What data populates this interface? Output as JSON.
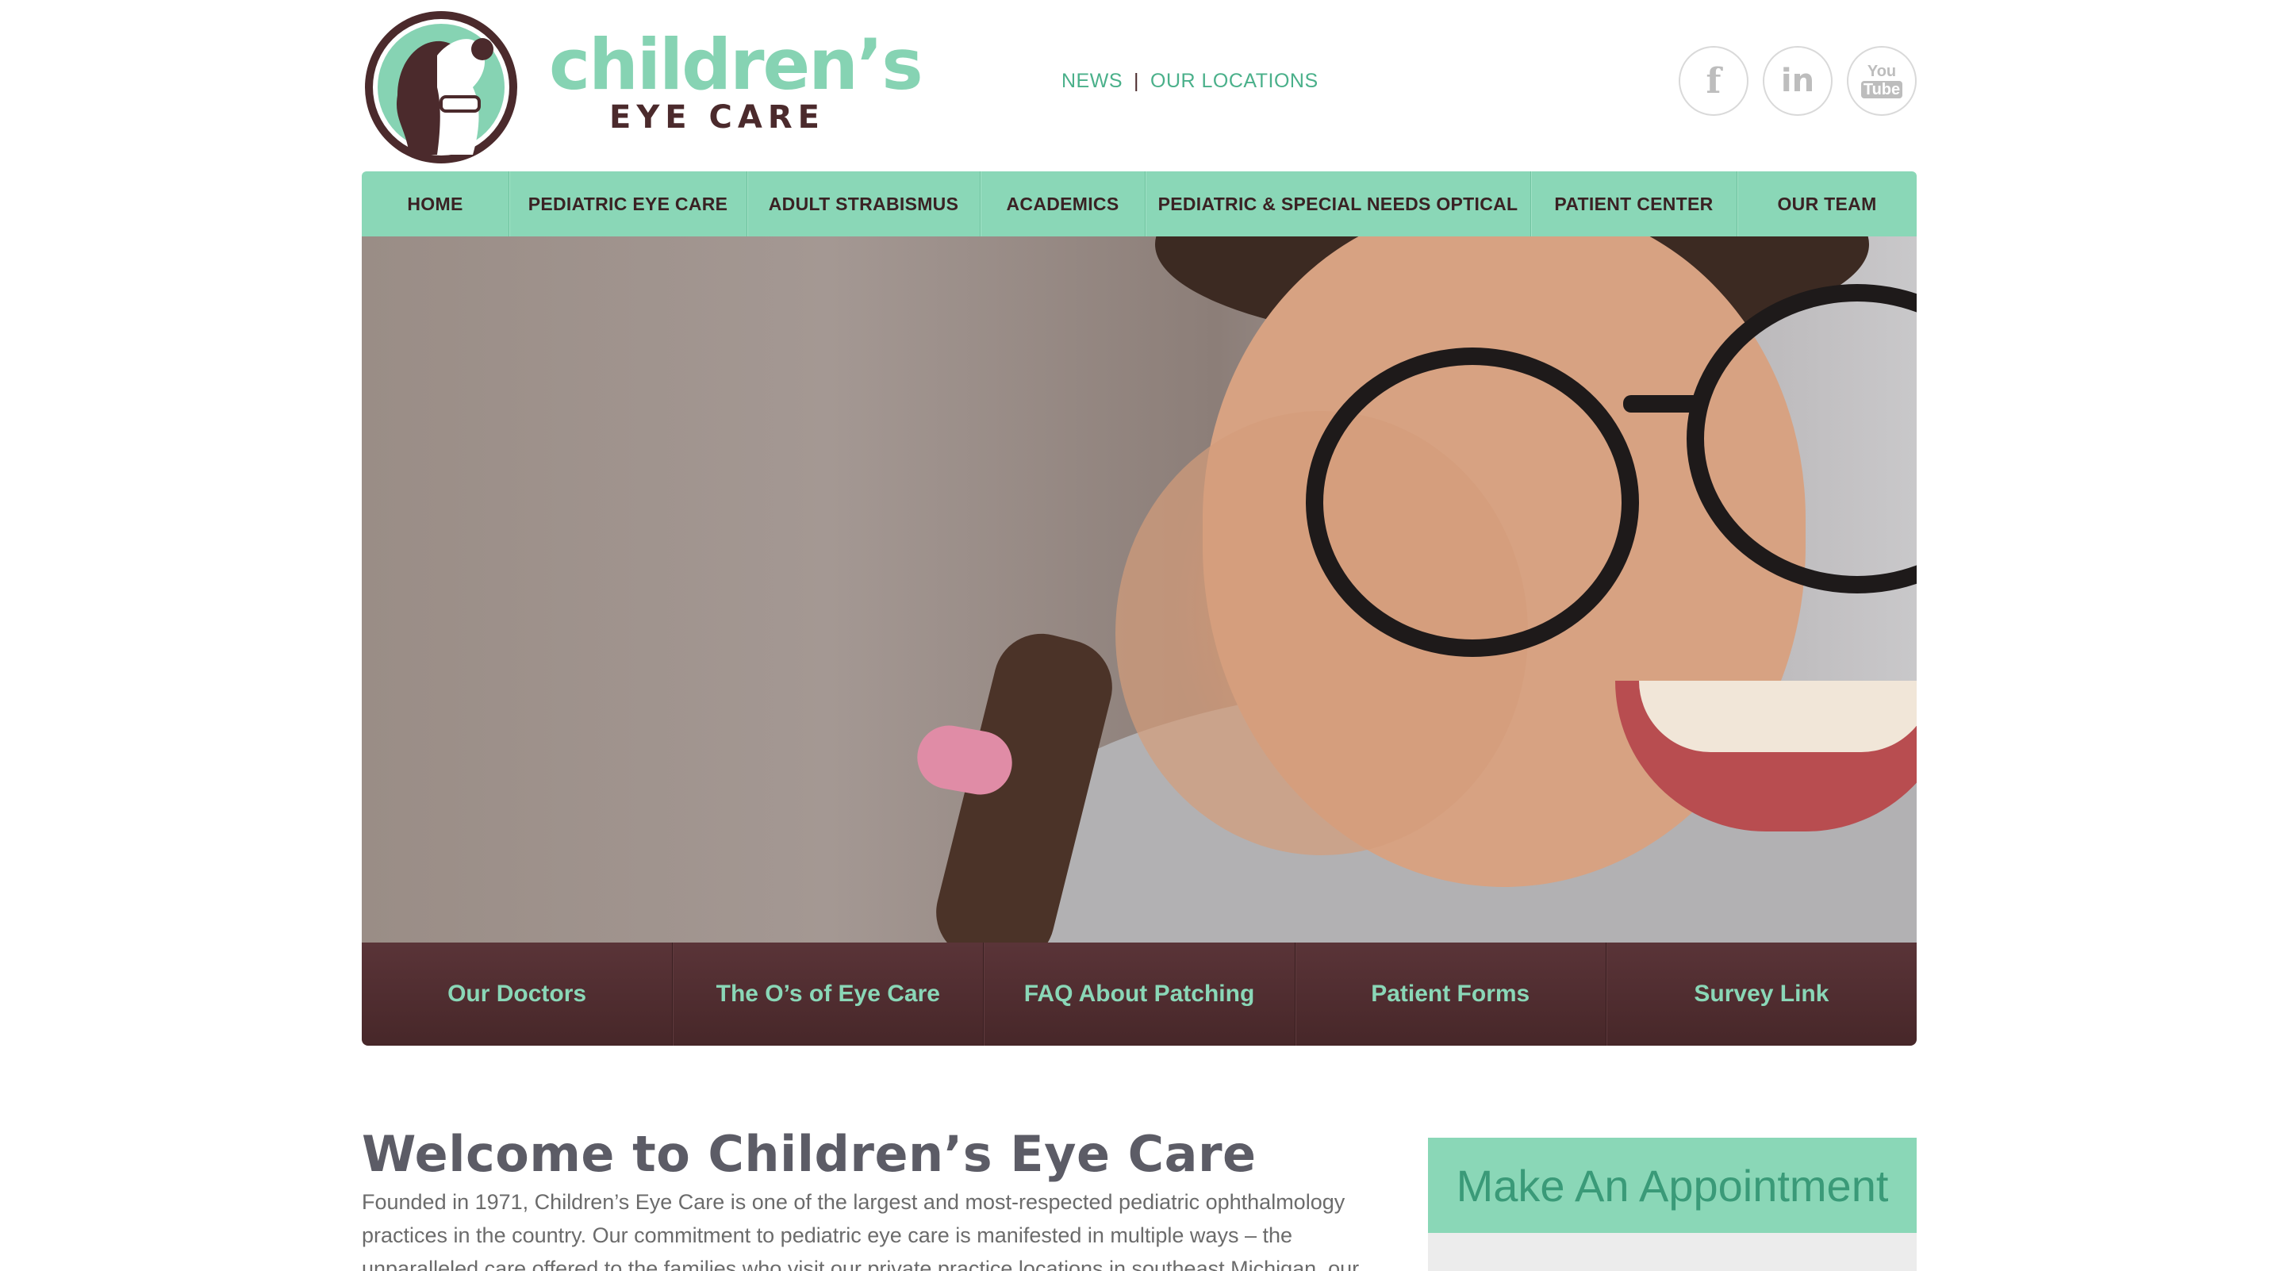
{
  "brand": {
    "name_top": "children’s",
    "name_bottom": "EYE CARE"
  },
  "toplinks": {
    "news": "NEWS",
    "separator": "|",
    "locations": "OUR LOCATIONS"
  },
  "social": {
    "facebook_glyph": "f",
    "linkedin_glyph": "in",
    "youtube_you": "You",
    "youtube_tube": "Tube"
  },
  "main_nav": [
    {
      "label": "HOME"
    },
    {
      "label": "PEDIATRIC EYE CARE"
    },
    {
      "label": "ADULT STRABISMUS"
    },
    {
      "label": "ACADEMICS"
    },
    {
      "label": "PEDIATRIC & SPECIAL NEEDS OPTICAL"
    },
    {
      "label": "PATIENT CENTER"
    },
    {
      "label": "OUR TEAM"
    }
  ],
  "sub_nav": [
    {
      "label": "Our Doctors"
    },
    {
      "label": "The O’s of Eye Care"
    },
    {
      "label": "FAQ About Patching"
    },
    {
      "label": "Patient Forms"
    },
    {
      "label": "Survey Link"
    }
  ],
  "content": {
    "title": "Welcome to Children’s Eye Care",
    "intro": "Founded in 1971, Children’s Eye Care is one of the largest and most-respected pediatric ophthalmology practices in the country. Our commitment to pediatric eye care is manifested in multiple ways – the unparalleled care offered to the families who visit our private practice locations in southeast Michigan, our"
  },
  "sidebar": {
    "appointment_title": "Make An Appointment"
  },
  "colors": {
    "mint": "#8ad7b7",
    "green_text": "#4ab08a",
    "maroon": "#4b2a2c",
    "heading_gray": "#5c5c66"
  }
}
